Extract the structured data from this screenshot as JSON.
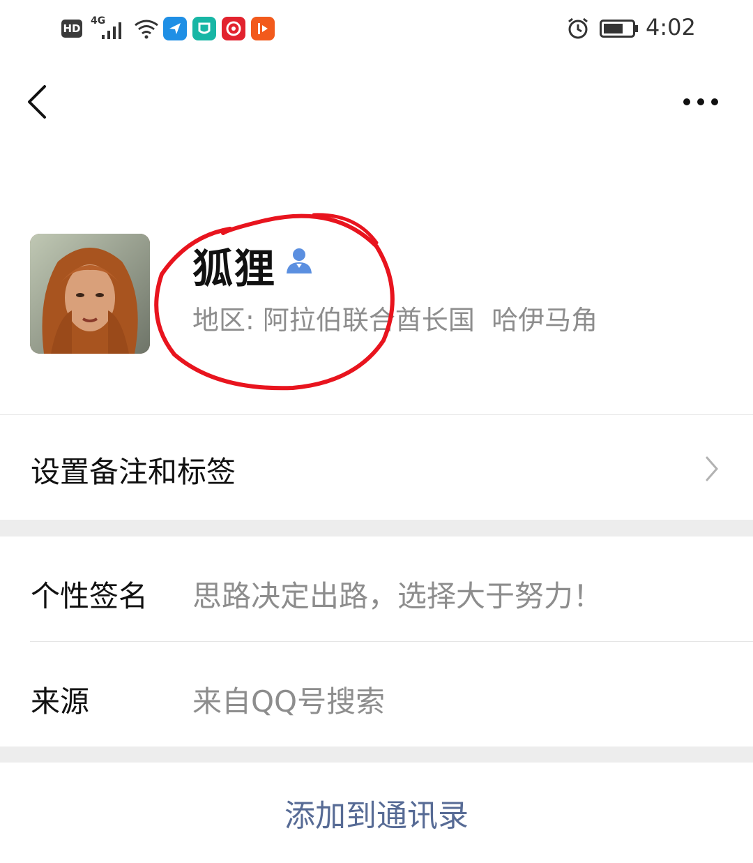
{
  "status_bar": {
    "hd": "HD",
    "network": "4G",
    "time": "4:02",
    "icons": [
      "signal-icon",
      "wifi-icon",
      "app-icon-blue",
      "app-icon-green",
      "app-icon-red",
      "app-icon-orange",
      "alarm-icon",
      "battery-icon"
    ]
  },
  "nav": {
    "back_icon": "chevron-left-icon",
    "more_icon": "more-icon"
  },
  "profile": {
    "name": "狐狸",
    "region_label": "地区:",
    "region_value": "阿拉伯联合酋长国  哈伊马角",
    "badge_icon": "person-icon",
    "annotation_color": "#e8141e"
  },
  "rows": {
    "remark": {
      "title": "设置备注和标签"
    },
    "signature": {
      "title": "个性签名",
      "value": "思路决定出路，选择大于努力！"
    },
    "source": {
      "title": "来源",
      "value": "来自QQ号搜索"
    }
  },
  "action": {
    "add_label": "添加到通讯录"
  },
  "colors": {
    "link": "#576b95",
    "muted": "#8d8d8d",
    "band": "#ededed"
  }
}
